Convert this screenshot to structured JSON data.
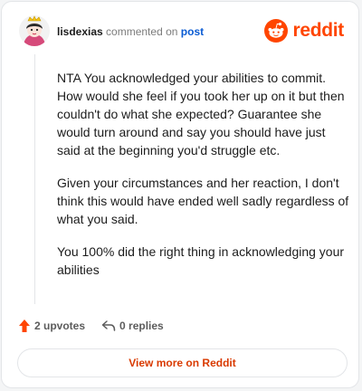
{
  "header": {
    "username": "lisdexias",
    "action_text": "commented on",
    "post_link": "post"
  },
  "brand": {
    "icon": "reddit-snoo-icon",
    "wordmark": "reddit",
    "color": "#ff4500"
  },
  "comment": {
    "paragraphs": [
      "NTA You acknowledged your abilities to commit. How would she feel if you took her up on it but then couldn't do what she expected? Guarantee she would turn around and say you should have just said at the beginning you'd struggle etc.",
      "Given your circumstances and her reaction, I don't think this would have ended well sadly regardless of what you said.",
      "You 100% did the right thing in acknowledging your abilities"
    ]
  },
  "actions": {
    "upvotes_label": "2 upvotes",
    "replies_label": "0 replies"
  },
  "footer": {
    "view_more_label": "View more on Reddit"
  }
}
